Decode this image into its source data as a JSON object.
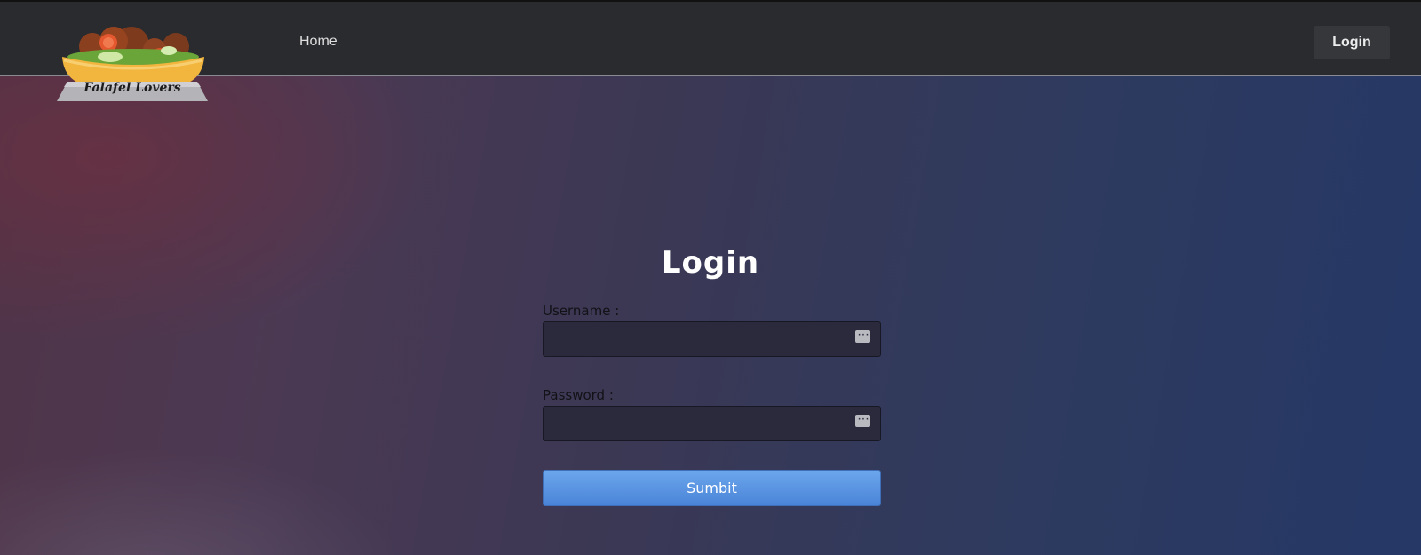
{
  "header": {
    "logo_text": "Falafel Lovers",
    "nav": {
      "home_label": "Home"
    },
    "login_button_label": "Login"
  },
  "form": {
    "title": "Login",
    "username": {
      "label": "Username :",
      "value": "",
      "placeholder": ""
    },
    "password": {
      "label": "Password :",
      "value": "",
      "placeholder": ""
    },
    "submit_label": "Sumbit"
  },
  "colors": {
    "navbar_bg": "#2a2b2f",
    "submit_bg": "#5a95e2",
    "input_bg": "#2b2a3d"
  },
  "icons": {
    "username_field_icon": "password-manager-icon",
    "password_field_icon": "password-manager-icon"
  }
}
